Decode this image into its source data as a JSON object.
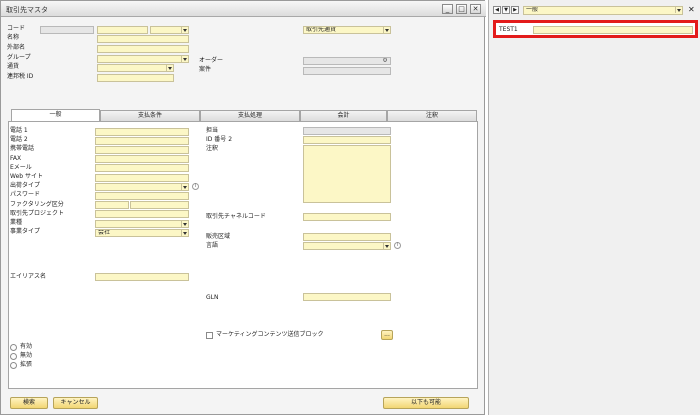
{
  "window": {
    "title": "取引先マスタ"
  },
  "header": {
    "code_label": "コード",
    "name_label": "名称",
    "foreign_name_label": "外部名",
    "group_label": "グループ",
    "currency_label": "通貨",
    "tax_id_label": "連邦税 ID",
    "bp_currency_select": "取引先通貨",
    "order_label": "オーダー",
    "order_value": "0",
    "project_label": "案件"
  },
  "tabs": [
    "一般",
    "支払条件",
    "支払処理",
    "会計",
    "注釈"
  ],
  "general": {
    "left_labels": [
      "電話 1",
      "電話 2",
      "携帯電話",
      "FAX",
      "Eメール",
      "Web サイト",
      "出荷タイプ",
      "パスワード",
      "ファクタリング区分",
      "取引先プロジェクト",
      "業種",
      "事業タイプ"
    ],
    "business_type_value": "会社",
    "alias_label": "エイリアス名",
    "contact_label": "担当",
    "id2_label": "ID 番号 2",
    "remarks_label": "注釈",
    "bp_channel_label": "取引先チャネルコード",
    "sales_region_label": "販売区域",
    "language_label": "言語",
    "gln_label": "GLN",
    "marketing_block_label": "マーケティングコンテンツ送信ブロック",
    "ellipsis_label": "...",
    "status_options": [
      "有効",
      "無効",
      "拡張"
    ]
  },
  "footer": {
    "search_button": "検索",
    "cancel_button": "キャンセル",
    "also_possible_button": "以下も可能"
  },
  "right_pane": {
    "nav_prev": "◀",
    "nav_mid": "▼",
    "nav_next": "▶",
    "dropdown_value": "一般",
    "close_symbol": "✕",
    "test_label": "TEST1"
  },
  "colors": {
    "field_yellow": "#fcf7c6",
    "highlight_red": "#e31b1b",
    "button_gold": "#f2d673"
  },
  "icons": [
    "minimize-icon",
    "maximize-icon",
    "close-icon",
    "chevron-down-icon",
    "info-icon"
  ]
}
